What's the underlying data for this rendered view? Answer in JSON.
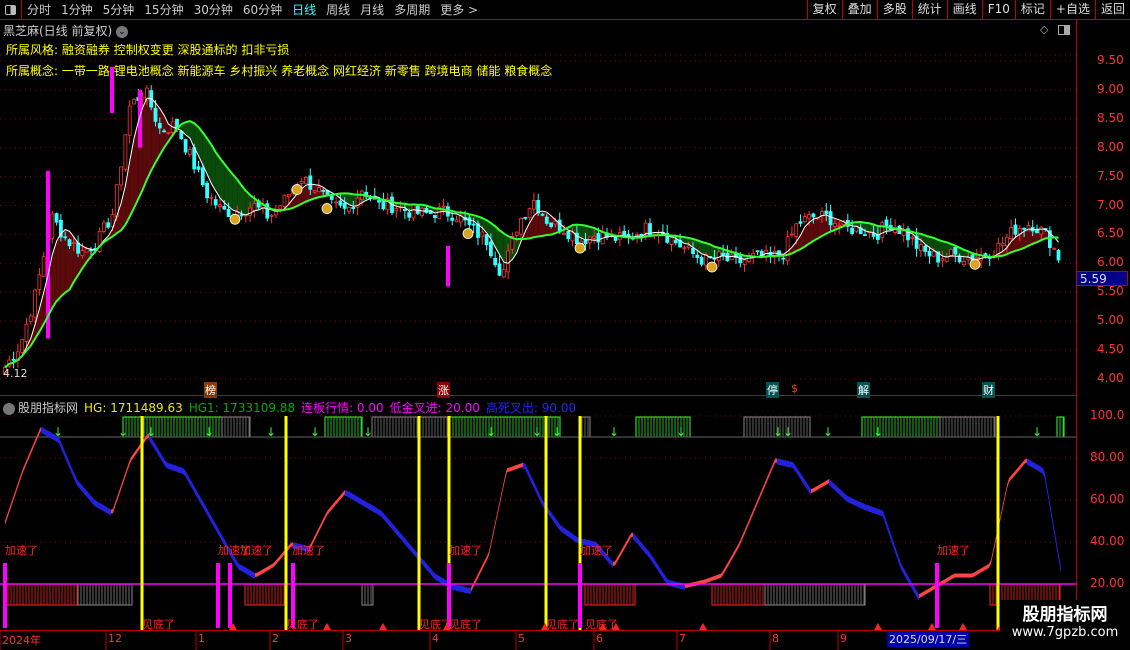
{
  "toolbar": {
    "periods": [
      "分时",
      "1分钟",
      "5分钟",
      "15分钟",
      "30分钟",
      "60分钟",
      "日线",
      "周线",
      "月线",
      "多周期",
      "更多 >"
    ],
    "active": "日线",
    "right_buttons": [
      "复权",
      "叠加",
      "多股",
      "统计",
      "画线",
      "F10",
      "标记",
      "+自选",
      "返回"
    ]
  },
  "stock": {
    "title": "黑芝麻(日线 前复权)",
    "style_label": "所属风格:",
    "style": "融资融券 控制权变更 深股通标的 扣非亏损",
    "concept_label": "所属概念:",
    "concepts": "一带一路 锂电池概念 新能源车 乡村振兴 养老概念 网红经济 新零售 跨境电商 储能 粮食概念"
  },
  "price_axis": {
    "labels": [
      "9.50",
      "9.00",
      "8.50",
      "8.00",
      "7.50",
      "7.00",
      "6.50",
      "6.00",
      "5.50",
      "5.00",
      "4.50",
      "4.00"
    ],
    "current": "5.59",
    "low_label": "4.12"
  },
  "event_markers": [
    "榜",
    "涨",
    "停",
    "$",
    "解",
    "财"
  ],
  "indicator": {
    "name": "股朋指标网",
    "items": [
      {
        "text": "HG: 1711489.63",
        "color": "#e8e800"
      },
      {
        "text": "HG1: 1733109.88",
        "color": "#0a0"
      },
      {
        "text": "连板行情: 0.00",
        "color": "#f0f"
      },
      {
        "text": "低金叉进: 20.00",
        "color": "#f0f"
      },
      {
        "text": "高死叉出: 90.00",
        "color": "#22f"
      }
    ],
    "axis": [
      "100.0",
      "80.00",
      "60.00",
      "40.00",
      "20.00"
    ],
    "accel_label": "加速了",
    "bottom_label": "见底了"
  },
  "time_axis": {
    "labels": [
      "2024年",
      "12",
      "1",
      "2",
      "3",
      "4",
      "5",
      "6",
      "7",
      "8",
      "9"
    ],
    "cursor_date": "2025/09/17/三"
  },
  "watermark": {
    "line1": "股朋指标网",
    "line2": "www.7gpzb.com"
  },
  "chart_data": {
    "type": "candlestick",
    "closes": [
      4.2,
      4.6,
      5.5,
      6.8,
      6.4,
      6.2,
      6.4,
      6.9,
      8.7,
      9.0,
      8.3,
      8.4,
      7.8,
      7.2,
      6.9,
      6.9,
      7.0,
      6.8,
      7.1,
      7.5,
      7.3,
      7.0,
      6.9,
      7.3,
      7.0,
      7.0,
      6.9,
      6.85,
      6.9,
      6.85,
      6.6,
      6.4,
      5.8,
      6.7,
      7.1,
      6.7,
      6.6,
      6.4,
      6.5,
      6.45,
      6.4,
      6.6,
      6.6,
      6.4,
      6.2,
      6.05,
      6.1,
      6.0,
      6.1,
      6.1,
      6.15,
      6.7,
      6.8,
      6.8,
      6.6,
      6.6,
      6.5,
      6.7,
      6.5,
      6.2,
      6.1,
      6.15,
      6.1,
      6.15,
      6.3,
      6.6,
      6.7,
      6.5,
      6.0
    ],
    "indicator": [
      50,
      75,
      95,
      90,
      70,
      60,
      55,
      80,
      92,
      78,
      75,
      60,
      45,
      30,
      25,
      30,
      40,
      38,
      55,
      65,
      60,
      55,
      45,
      35,
      25,
      20,
      18,
      35,
      75,
      78,
      60,
      48,
      42,
      40,
      30,
      45,
      35,
      22,
      20,
      22,
      25,
      40,
      60,
      80,
      78,
      65,
      70,
      62,
      58,
      55,
      30,
      15,
      20,
      25,
      25,
      30,
      70,
      80,
      75,
      25
    ],
    "ylim": [
      4.0,
      9.5
    ]
  }
}
